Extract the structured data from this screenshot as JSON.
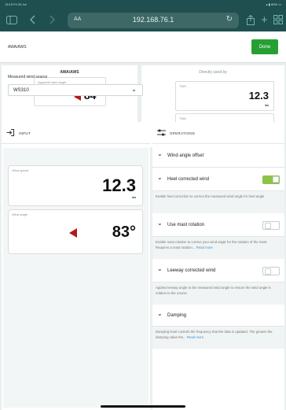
{
  "status_bar": {
    "time": "13:19  Fri 29 Jul",
    "indicators": "▴ ▮ 80% ▭"
  },
  "safari": {
    "text_size_label": "AA",
    "url": "192.168.76.1",
    "icons": [
      "sidebar-icon",
      "back-icon",
      "forward-icon",
      "reload-icon",
      "share-icon",
      "new-tab-icon",
      "tabs-icon"
    ]
  },
  "header": {
    "title": "AWA/AWS",
    "done_label": "Done"
  },
  "awa_card": {
    "title": "AWA/AWS",
    "label": "Apparent wind angle",
    "value": "84°"
  },
  "direct_card": {
    "title": "Directly used by",
    "tws_label": "TWS",
    "tws_value": "12.3",
    "tws_unit": "kn",
    "twa_label": "TWA"
  },
  "input_panel": {
    "title": "INPUT",
    "source_label": "Measured wind source",
    "source_value": "WS310",
    "speed": {
      "label": "Wind speed",
      "value": "12.3",
      "unit": "kn"
    },
    "angle": {
      "label": "Wind angle",
      "value": "83°"
    }
  },
  "operations_panel": {
    "title": "OPERATIONS",
    "items": [
      {
        "title": "Wind angle offset"
      },
      {
        "title": "Heel corrected wind",
        "toggle": "on",
        "desc": "Enable heel correction to correct the measured wind angle for heel angle"
      },
      {
        "title": "Use mast rotation",
        "toggle": "off",
        "desc": "Enable mast rotation to correct your wind angle for the rotation of the mast. Requires a mast rotation...",
        "more": "Read more"
      },
      {
        "title": "Leeway corrected wind",
        "toggle": "off",
        "desc": "Applies leeway angle to the measured wind angle to ensure the wind angle is relative to the course"
      },
      {
        "title": "Damping",
        "desc": "Damping level controls the frequency that the data is updated. The greater the damping value the...",
        "more": "Read more"
      }
    ]
  },
  "colors": {
    "accent": "#27a033",
    "toggle_on": "#8dc34a",
    "arrow": "#b31b1b",
    "link": "#3b93d2",
    "browser_chrome": "#1f4f4e"
  }
}
